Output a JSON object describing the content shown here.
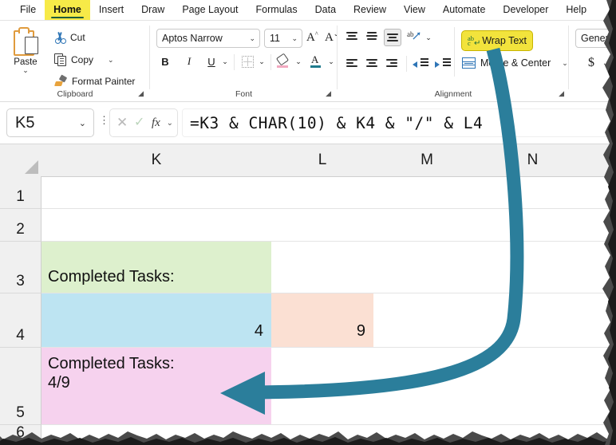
{
  "app": {
    "name": "Microsoft Excel",
    "accent_yellow": "#f7ea48",
    "accent_teal": "#2b7e9b",
    "highlight_yellow": "#f2e33c"
  },
  "ribbon": {
    "tabs": [
      {
        "label": "File",
        "active": false
      },
      {
        "label": "Home",
        "active": true
      },
      {
        "label": "Insert",
        "active": false
      },
      {
        "label": "Draw",
        "active": false
      },
      {
        "label": "Page Layout",
        "active": false
      },
      {
        "label": "Formulas",
        "active": false
      },
      {
        "label": "Data",
        "active": false
      },
      {
        "label": "Review",
        "active": false
      },
      {
        "label": "View",
        "active": false
      },
      {
        "label": "Automate",
        "active": false
      },
      {
        "label": "Developer",
        "active": false
      },
      {
        "label": "Help",
        "active": false
      }
    ],
    "clipboard": {
      "group_label": "Clipboard",
      "paste_label": "Paste",
      "cut_label": "Cut",
      "copy_label": "Copy",
      "format_painter_label": "Format Painter"
    },
    "font": {
      "group_label": "Font",
      "font_name": "Aptos Narrow",
      "font_size": "11",
      "bold_label": "B",
      "italic_label": "I",
      "underline_label": "U"
    },
    "alignment": {
      "group_label": "Alignment",
      "wrap_text_label": "Wrap Text",
      "merge_center_label": "Merge & Center",
      "wrap_text_highlighted": true
    },
    "number": {
      "format_value": "General",
      "currency_label": "$"
    }
  },
  "formula_bar": {
    "name_box_value": "K5",
    "formula": "=K3 & CHAR(10) & K4 & \"/\" & L4",
    "cancel_icon": "✕",
    "enter_icon": "✓",
    "fx_label": "fx"
  },
  "sheet": {
    "columns": [
      "K",
      "L",
      "M",
      "N"
    ],
    "rows": [
      "1",
      "2",
      "3",
      "4",
      "5",
      "6"
    ],
    "cells": [
      {
        "ref": "K3",
        "value": "Completed Tasks:",
        "fill": "#ddf0cd",
        "align": "left",
        "row": "3",
        "col": "K"
      },
      {
        "ref": "K4",
        "value": "4",
        "fill": "#bde4f2",
        "align": "right",
        "row": "4",
        "col": "K"
      },
      {
        "ref": "L4",
        "value": "9",
        "fill": "#fbe0d3",
        "align": "right",
        "row": "4",
        "col": "L"
      },
      {
        "ref": "K5",
        "value": "Completed Tasks:\n4/9",
        "fill": "#f6d2ee",
        "align": "left",
        "row": "5",
        "col": "K"
      }
    ]
  },
  "annotation": {
    "arrow_color": "#2b7e9b",
    "points_from": "Wrap Text",
    "points_to": "K5"
  }
}
